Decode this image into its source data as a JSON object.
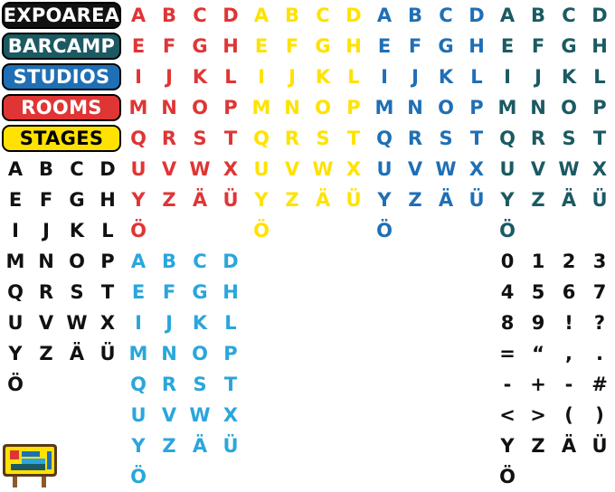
{
  "categories": [
    {
      "label": "EXPOAREA",
      "bg": "#111111",
      "fg": "#ffffff"
    },
    {
      "label": "BARCAMP",
      "bg": "#1b5a62",
      "fg": "#ffffff"
    },
    {
      "label": "STUDIOS",
      "bg": "#1f6fb5",
      "fg": "#ffffff"
    },
    {
      "label": "ROOMS",
      "bg": "#e03535",
      "fg": "#ffffff"
    },
    {
      "label": "STAGES",
      "bg": "#ffe200",
      "fg": "#000000"
    }
  ],
  "colors": {
    "red": "#e03535",
    "yellow": "#ffe200",
    "blue": "#1f6fb5",
    "teal": "#1b5a62",
    "black": "#111111",
    "lightblue": "#2aa6dc"
  },
  "alphabet": [
    "A",
    "B",
    "C",
    "D",
    "E",
    "F",
    "G",
    "H",
    "I",
    "J",
    "K",
    "L",
    "M",
    "N",
    "O",
    "P",
    "Q",
    "R",
    "S",
    "T",
    "U",
    "V",
    "W",
    "X",
    "Y",
    "Z",
    "Ä",
    "Ü",
    "Ö"
  ],
  "symbols": [
    "0",
    "1",
    "2",
    "3",
    "4",
    "5",
    "6",
    "7",
    "8",
    "9",
    "!",
    "?",
    "=",
    "“",
    ",",
    ".",
    "-",
    "+",
    "-",
    "#",
    "<",
    ">",
    "(",
    ")",
    "Y",
    "Z",
    "Ä",
    "Ü",
    "Ö"
  ],
  "sign_icon": "signpost-icon"
}
